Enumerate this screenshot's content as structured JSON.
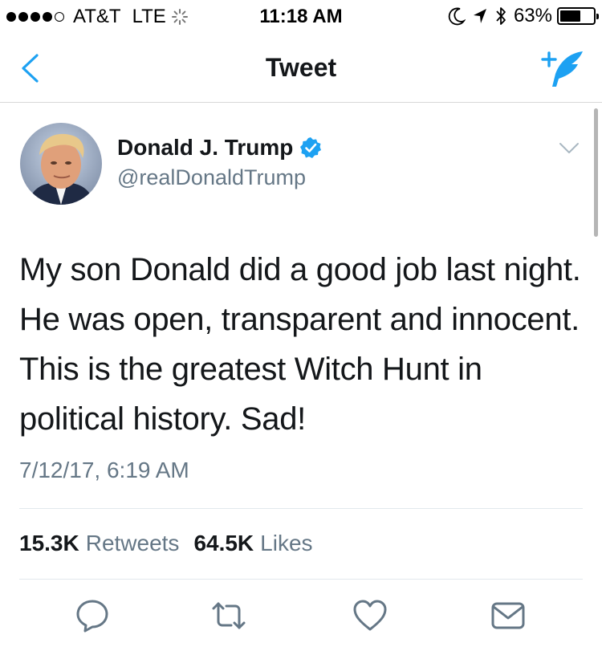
{
  "status_bar": {
    "carrier": "AT&T",
    "network": "LTE",
    "time": "11:18 AM",
    "battery_percent": "63%",
    "battery_level": 0.63,
    "signal_bars": 4,
    "icons": [
      "moon-icon",
      "location-arrow-icon",
      "bluetooth-icon"
    ]
  },
  "nav": {
    "title": "Tweet",
    "back_icon": "chevron-left-icon",
    "compose_icon": "compose-quill-icon"
  },
  "tweet": {
    "display_name": "Donald J. Trump",
    "handle": "@realDonaldTrump",
    "verified": true,
    "text": "My son Donald did a good job last night. He was open, transparent and innocent. This is the greatest Witch Hunt in political history. Sad!",
    "timestamp": "7/12/17, 6:19 AM",
    "retweets_count": "15.3K",
    "retweets_label": "Retweets",
    "likes_count": "64.5K",
    "likes_label": "Likes"
  },
  "actions": [
    "reply-icon",
    "retweet-icon",
    "like-icon",
    "direct-message-icon"
  ],
  "colors": {
    "accent": "#1da1f2",
    "text": "#14171a",
    "secondary": "#657786",
    "divider": "#e1e8ed"
  }
}
